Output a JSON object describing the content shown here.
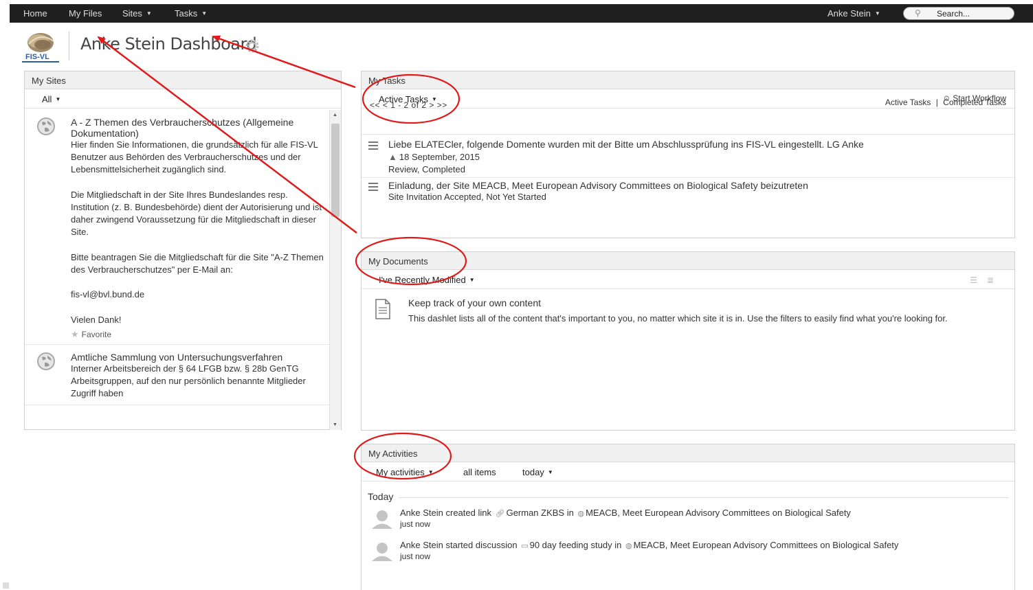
{
  "topnav": {
    "home": "Home",
    "my_files": "My Files",
    "sites": "Sites",
    "tasks": "Tasks",
    "user": "Anke Stein",
    "search_placeholder": "Search..."
  },
  "header": {
    "logo_text": "FIS-VL",
    "title": "Anke Stein Dashboard",
    "settings_icon": "gear-icon"
  },
  "my_sites": {
    "title": "My Sites",
    "filter": "All",
    "sites": [
      {
        "name": "A - Z Themen des Verbraucherschutzes (Allgemeine Dokumentation)",
        "description": "Hier finden Sie Informationen, die grundsätzlich für alle FIS-VL Benutzer aus Behörden des Verbraucherschutzes und der Lebensmittelsicherheit zugänglich sind.\n\n   Die Mitgliedschaft in der Site Ihres Bundeslandes resp. Institution (z. B. Bundesbehörde) dient der Autorisierung und ist daher zwingend Voraussetzung für die Mitgliedschaft in dieser Site.\n\n   Bitte beantragen Sie die Mitgliedschaft für die Site \"A-Z Themen des Verbraucherschutzes\" per E-Mail an:\n\n   fis-vl@bvl.bund.de\n\n   Vielen Dank!",
        "favorite": "Favorite"
      },
      {
        "name": "Amtliche Sammlung von Untersuchungsverfahren",
        "description": "Interner Arbeitsbereich der § 64 LFGB bzw. § 28b GenTG Arbeitsgruppen, auf den nur persönlich benannte Mitglieder Zugriff haben"
      }
    ]
  },
  "my_tasks": {
    "title": "My Tasks",
    "filter": "Active Tasks",
    "start_workflow": "Start Workflow",
    "pager": "<<  <  1 - 2 of 2  >  >>",
    "link_active": "Active Tasks",
    "link_separator": "|",
    "link_completed": "Completed Tasks",
    "tasks": [
      {
        "title": "Liebe ELATECler, folgende Domente wurden mit der Bitte um Abschlussprüfung ins FIS-VL eingestellt. LG Anke",
        "date": "18 September, 2015",
        "status": "Review, Completed"
      },
      {
        "title": "Einladung, der Site MEACB, Meet European Advisory Committees on Biological Safety beizutreten",
        "status": "Site Invitation Accepted, Not Yet Started"
      }
    ]
  },
  "my_documents": {
    "title": "My Documents",
    "filter": "I've Recently Modified",
    "empty_title": "Keep track of your own content",
    "empty_text": "This dashlet lists all of the content that's important to you, no matter which site it is in. Use the filters to easily find what you're looking for."
  },
  "my_activities": {
    "title": "My Activities",
    "filter_user": "My activities",
    "filter_items": "all items",
    "filter_range": "today",
    "day_label": "Today",
    "items": [
      {
        "actor": "Anke Stein",
        "verb": "created link",
        "object": "German ZKBS",
        "prep": "in",
        "site": "MEACB, Meet European Advisory Committees on Biological Safety",
        "time": "just now"
      },
      {
        "actor": "Anke Stein",
        "verb": "started discussion",
        "object": "90 day feeding study",
        "prep": "in",
        "site": "MEACB, Meet European Advisory Committees on Biological Safety",
        "time": "just now"
      }
    ]
  },
  "colors": {
    "annotation": "#e01a1a",
    "topbar": "#1f1f1f"
  }
}
